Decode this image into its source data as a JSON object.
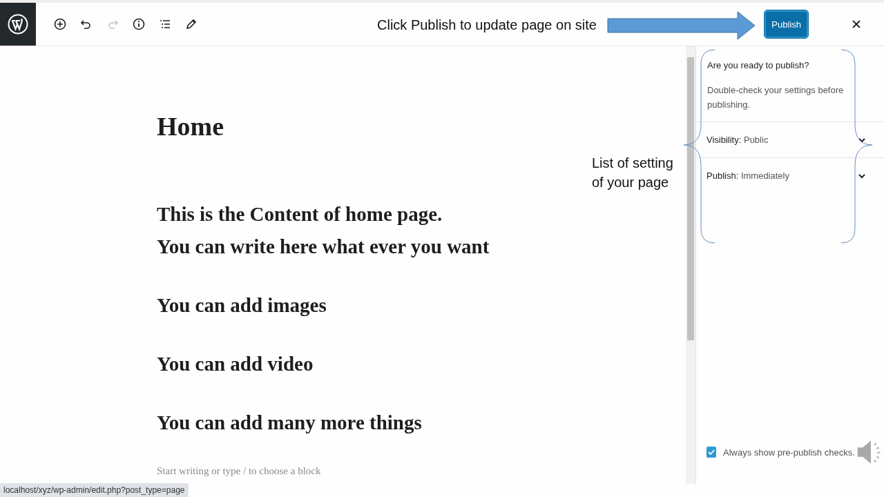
{
  "toolbar": [
    {
      "kind": "add",
      "disabled": false
    },
    {
      "kind": "undo",
      "disabled": false
    },
    {
      "kind": "redo",
      "disabled": true
    },
    {
      "kind": "info",
      "disabled": false
    },
    {
      "kind": "outline",
      "disabled": false
    },
    {
      "kind": "edit",
      "disabled": false
    }
  ],
  "publish_button": "Publish",
  "editor": {
    "title": "Home",
    "paragraphs": [
      {
        "lines": [
          "This is the Content of home page.",
          "You can write here what ever you want"
        ]
      },
      {
        "lines": [
          "You can add images"
        ]
      },
      {
        "lines": [
          "You can add video"
        ]
      },
      {
        "lines": [
          "You can add many more things"
        ]
      }
    ],
    "placeholder": "Start writing or type / to choose a block"
  },
  "sidebar": {
    "heading": "Are you ready to publish?",
    "description": "Double-check your settings before publishing.",
    "settings": [
      {
        "label": "Visibility:",
        "value": "Public",
        "expanded": false
      },
      {
        "label": "Publish:",
        "value": "Immediately",
        "expanded": false
      }
    ],
    "checkbox": {
      "label": "Always show pre-publish checks.",
      "checked": true
    }
  },
  "annotations": [
    {
      "text": "Click Publish to update page on site"
    },
    {
      "text": "List of setting of your page"
    }
  ],
  "status_bar": "localhost/xyz/wp-admin/edit.php?post_type=page"
}
